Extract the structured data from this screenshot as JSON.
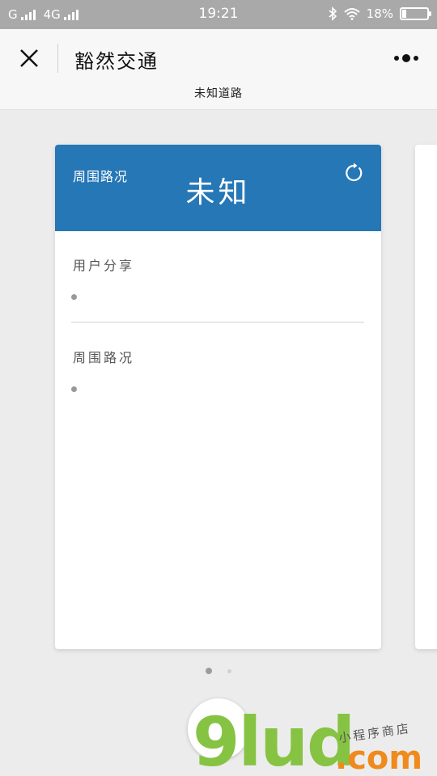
{
  "status_bar": {
    "carrier1": "G",
    "carrier2": "4G",
    "time": "19:21",
    "battery_text": "18%",
    "battery_level": 0.18
  },
  "title_bar": {
    "title": "豁然交通",
    "subtitle": "未知道路"
  },
  "card": {
    "header_label": "周围路况",
    "status": "未知",
    "header_color": "#2577b6",
    "section1_title": "用户分享",
    "section2_title": "周围路况"
  },
  "pager": {
    "current_page": 1,
    "total_pages": 2
  },
  "watermark": {
    "brand": "9lud",
    "domain": ".com",
    "tag": "小程序商店"
  },
  "icons": [
    "bluetooth-icon",
    "wifi-icon",
    "battery-icon",
    "close-icon",
    "more-icon",
    "refresh-icon"
  ]
}
